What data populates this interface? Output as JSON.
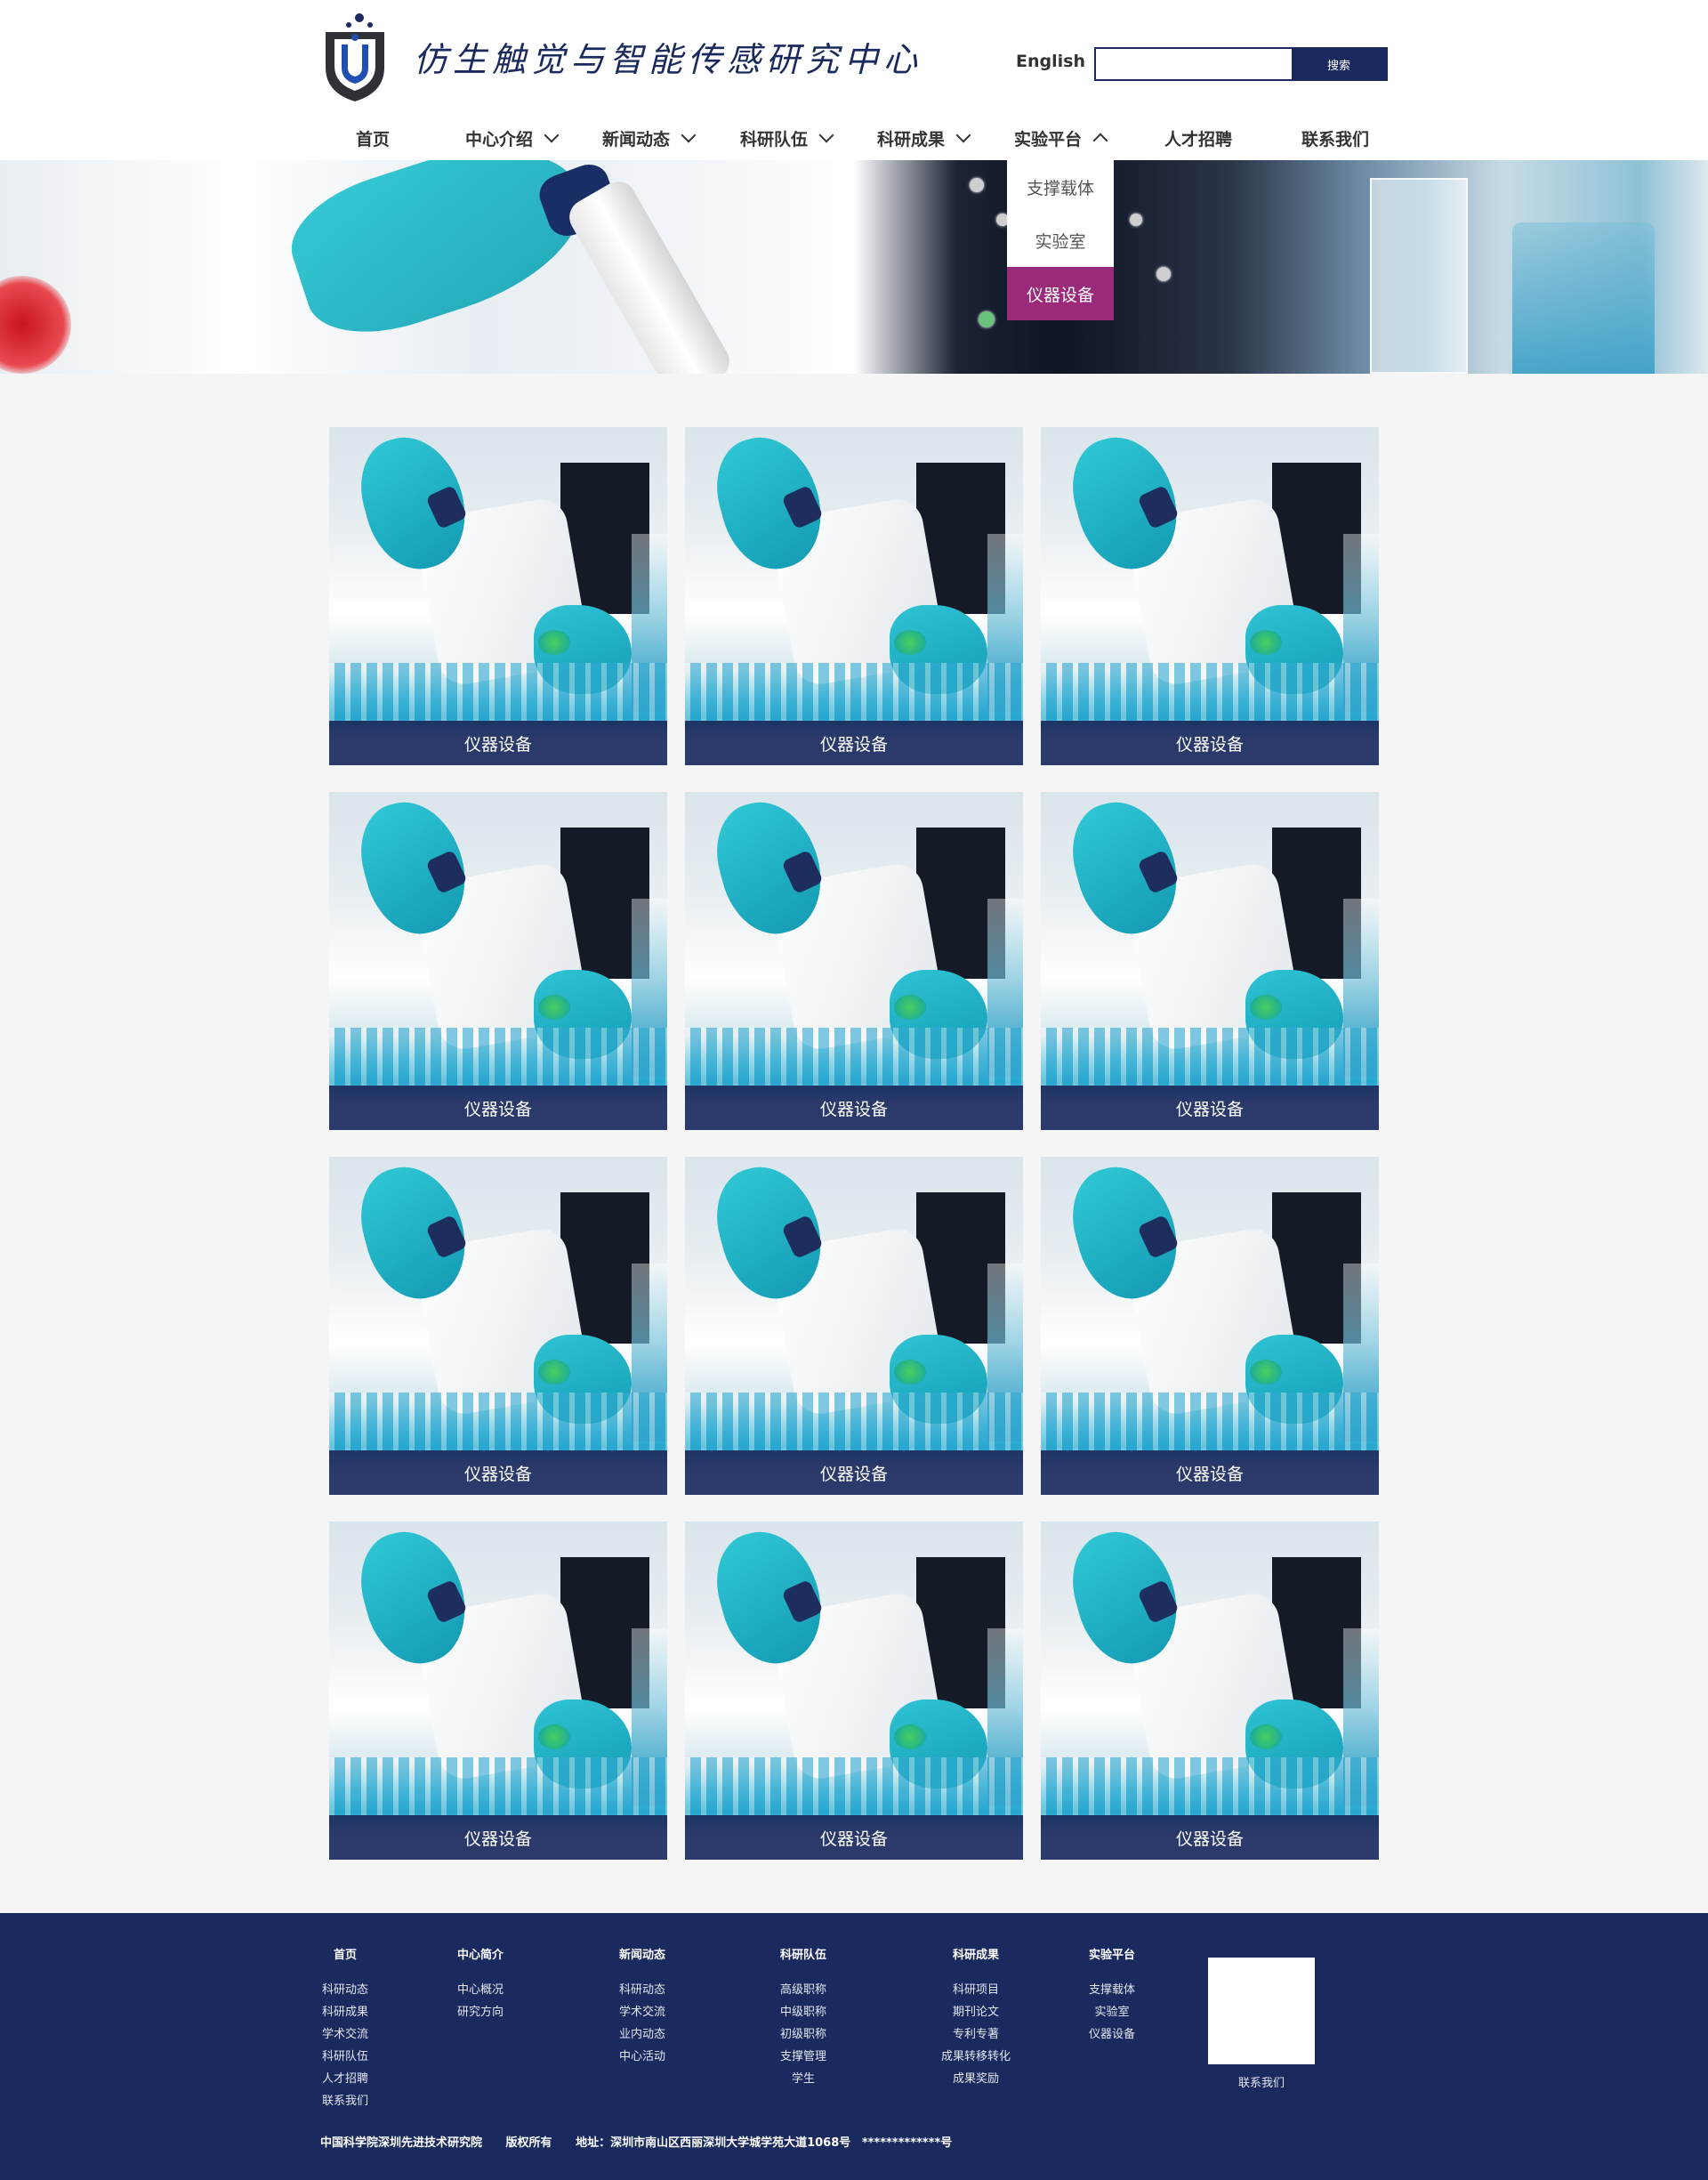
{
  "header": {
    "site_title": "仿生触觉与智能传感研究中心",
    "english_label": "English",
    "search_placeholder": "",
    "search_button": "搜索"
  },
  "nav": {
    "items": [
      {
        "label": "首页",
        "has_dropdown": false
      },
      {
        "label": "中心介绍",
        "has_dropdown": true
      },
      {
        "label": "新闻动态",
        "has_dropdown": true
      },
      {
        "label": "科研队伍",
        "has_dropdown": true
      },
      {
        "label": "科研成果",
        "has_dropdown": true
      },
      {
        "label": "实验平台",
        "has_dropdown": true,
        "expanded": true
      },
      {
        "label": "人才招聘",
        "has_dropdown": false
      },
      {
        "label": "联系我们",
        "has_dropdown": false
      }
    ]
  },
  "dropdown": {
    "items": [
      "支撑载体",
      "实验室",
      "仪器设备"
    ],
    "active": "仪器设备"
  },
  "cards": [
    {
      "label": "仪器设备"
    },
    {
      "label": "仪器设备"
    },
    {
      "label": "仪器设备"
    },
    {
      "label": "仪器设备"
    },
    {
      "label": "仪器设备"
    },
    {
      "label": "仪器设备"
    },
    {
      "label": "仪器设备"
    },
    {
      "label": "仪器设备"
    },
    {
      "label": "仪器设备"
    },
    {
      "label": "仪器设备"
    },
    {
      "label": "仪器设备"
    },
    {
      "label": "仪器设备"
    }
  ],
  "footer": {
    "columns": [
      {
        "heading": "首页",
        "items": [
          "科研动态",
          "科研成果",
          "学术交流",
          "科研队伍",
          "人才招聘",
          "联系我们"
        ]
      },
      {
        "heading": "中心简介",
        "items": [
          "中心概况",
          "研究方向"
        ]
      },
      {
        "heading": "新闻动态",
        "items": [
          "科研动态",
          "学术交流",
          "业内动态",
          "中心活动"
        ]
      },
      {
        "heading": "科研队伍",
        "items": [
          "高级职称",
          "中级职称",
          "初级职称",
          "支撑管理",
          "学生"
        ]
      },
      {
        "heading": "科研成果",
        "items": [
          "科研项目",
          "期刊论文",
          "专利专著",
          "成果转移转化",
          "成果奖励"
        ]
      },
      {
        "heading": "实验平台",
        "items": [
          "支撑载体",
          "实验室",
          "仪器设备"
        ]
      }
    ],
    "qr_label": "联系我们",
    "copyright": {
      "org": "中国科学院深圳先进技术研究院",
      "rights": "版权所有",
      "address": "地址：深圳市南山区西丽深圳大学城学苑大道1068号",
      "icp": "*************号"
    }
  },
  "colors": {
    "brand_navy": "#1b2a5e",
    "dropdown_active": "#9c2a7b",
    "footer_bg": "#1a2a5e",
    "main_bg": "#f5f5f5"
  },
  "icons": {
    "logo": "shield-logo-icon",
    "nav_chevron_down": "chevron-down-icon",
    "nav_chevron_up": "chevron-up-icon"
  }
}
